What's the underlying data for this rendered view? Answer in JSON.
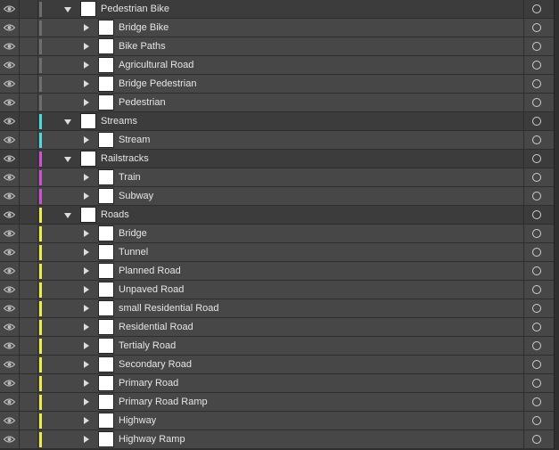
{
  "layers": [
    {
      "name": "Pedestrian Bike",
      "level": 0,
      "expanded": true,
      "color": "#6e6e6e"
    },
    {
      "name": "Bridge Bike",
      "level": 1,
      "expanded": false,
      "color": "#6e6e6e"
    },
    {
      "name": "Bike Paths",
      "level": 1,
      "expanded": false,
      "color": "#6e6e6e"
    },
    {
      "name": "Agricultural Road",
      "level": 1,
      "expanded": false,
      "color": "#6e6e6e"
    },
    {
      "name": "Bridge Pedestrian",
      "level": 1,
      "expanded": false,
      "color": "#6e6e6e"
    },
    {
      "name": "Pedestrian",
      "level": 1,
      "expanded": false,
      "color": "#6e6e6e"
    },
    {
      "name": "Streams",
      "level": 0,
      "expanded": true,
      "color": "#4fd9e0"
    },
    {
      "name": "Stream",
      "level": 1,
      "expanded": false,
      "color": "#4fd9e0"
    },
    {
      "name": "Railstracks",
      "level": 0,
      "expanded": true,
      "color": "#d04fd6"
    },
    {
      "name": "Train",
      "level": 1,
      "expanded": false,
      "color": "#d04fd6"
    },
    {
      "name": "Subway",
      "level": 1,
      "expanded": false,
      "color": "#d04fd6"
    },
    {
      "name": "Roads",
      "level": 0,
      "expanded": true,
      "color": "#eeee4a"
    },
    {
      "name": "Bridge",
      "level": 1,
      "expanded": false,
      "color": "#eeee4a"
    },
    {
      "name": "Tunnel",
      "level": 1,
      "expanded": false,
      "color": "#eeee4a"
    },
    {
      "name": "Planned Road",
      "level": 1,
      "expanded": false,
      "color": "#eeee4a"
    },
    {
      "name": "Unpaved Road",
      "level": 1,
      "expanded": false,
      "color": "#eeee4a"
    },
    {
      "name": "small Residential Road",
      "level": 1,
      "expanded": false,
      "color": "#eeee4a"
    },
    {
      "name": "Residential Road",
      "level": 1,
      "expanded": false,
      "color": "#eeee4a"
    },
    {
      "name": "Tertialy Road",
      "level": 1,
      "expanded": false,
      "color": "#eeee4a"
    },
    {
      "name": "Secondary Road",
      "level": 1,
      "expanded": false,
      "color": "#eeee4a"
    },
    {
      "name": "Primary Road",
      "level": 1,
      "expanded": false,
      "color": "#eeee4a"
    },
    {
      "name": "Primary Road Ramp",
      "level": 1,
      "expanded": false,
      "color": "#eeee4a"
    },
    {
      "name": "Highway",
      "level": 1,
      "expanded": false,
      "color": "#eeee4a"
    },
    {
      "name": "Highway Ramp",
      "level": 1,
      "expanded": false,
      "color": "#eeee4a"
    }
  ],
  "icons": {
    "visibility": "eye-icon",
    "target": "target-circle-icon"
  }
}
